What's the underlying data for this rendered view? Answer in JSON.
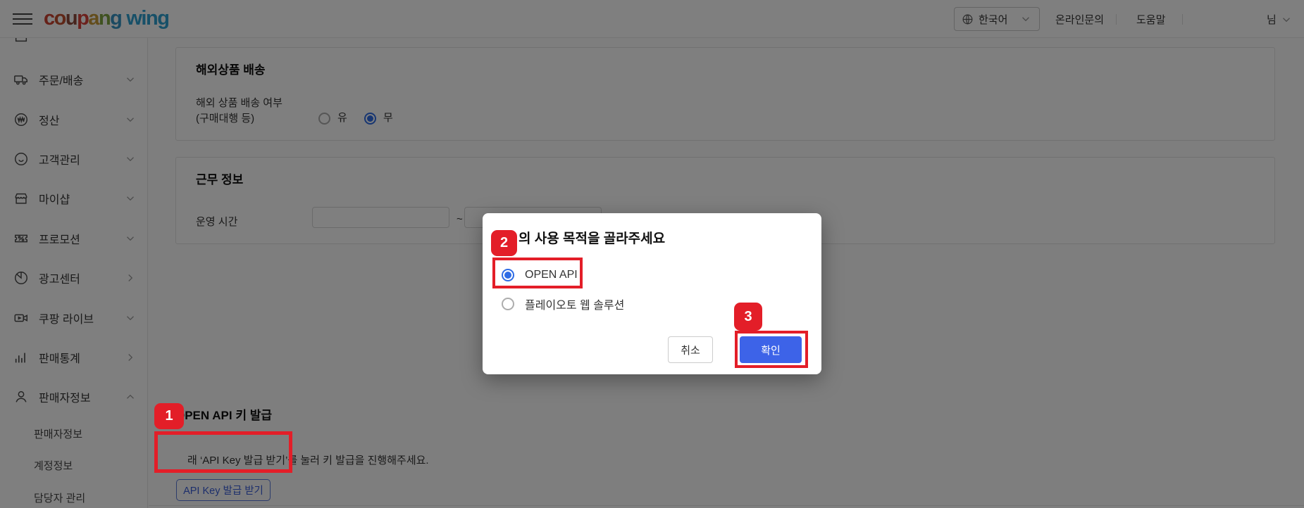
{
  "header": {
    "logo_letters": [
      {
        "ch": "c",
        "color": "#cc4232"
      },
      {
        "ch": "o",
        "color": "#c14f2f"
      },
      {
        "ch": "u",
        "color": "#8f4a3d"
      },
      {
        "ch": "p",
        "color": "#d8423a"
      },
      {
        "ch": "a",
        "color": "#c79a38"
      },
      {
        "ch": "n",
        "color": "#7fa441"
      },
      {
        "ch": "g",
        "color": "#3794c4"
      }
    ],
    "logo_wing": {
      "ch": "wing",
      "color": "#2fa0d0"
    },
    "language_label": "한국어",
    "link_inquiry": "온라인문의",
    "link_help": "도움말",
    "user_label": "님"
  },
  "sidebar": {
    "items": [
      {
        "label": "주문/배송"
      },
      {
        "label": "정산"
      },
      {
        "label": "고객관리"
      },
      {
        "label": "마이샵"
      },
      {
        "label": "프로모션"
      },
      {
        "label": "광고센터"
      },
      {
        "label": "쿠팡 라이브"
      },
      {
        "label": "판매통계"
      },
      {
        "label": "판매자정보"
      }
    ],
    "sub_items": [
      {
        "label": "판매자정보"
      },
      {
        "label": "계정정보"
      },
      {
        "label": "담당자 관리"
      }
    ]
  },
  "main": {
    "overseas_card": {
      "title": "해외상품 배송",
      "label_line1": "해외 상품 배송 여부",
      "label_line2": "(구매대행 등)",
      "radio_yes": "유",
      "radio_no": "무",
      "selected_value": "무"
    },
    "work_card": {
      "title": "근무 정보",
      "label": "운영 시간",
      "separator": "~",
      "input1_value": "",
      "input2_value": ""
    },
    "api_section": {
      "title": "OPEN API 키 발급",
      "description": "래 ‘API Key 발급 받기’를 눌러 키 발급을 진행해주세요.",
      "button_label": "API Key 발급 받기"
    }
  },
  "modal": {
    "title": "의 사용 목적을 골라주세요",
    "options": [
      {
        "label": "OPEN API",
        "selected": true
      },
      {
        "label": "플레이오토 웹 솔루션",
        "selected": false
      }
    ],
    "cancel_label": "취소",
    "confirm_label": "확인"
  },
  "annotations": {
    "step1": "1",
    "step2": "2",
    "step3": "3"
  },
  "colors": {
    "annotation_red": "#e31e28",
    "confirm_blue": "#3d63e8",
    "radio_blue": "#2f6ce5",
    "api_button_blue": "#3a5ed8",
    "wing_blue": "#2fa0d0"
  }
}
